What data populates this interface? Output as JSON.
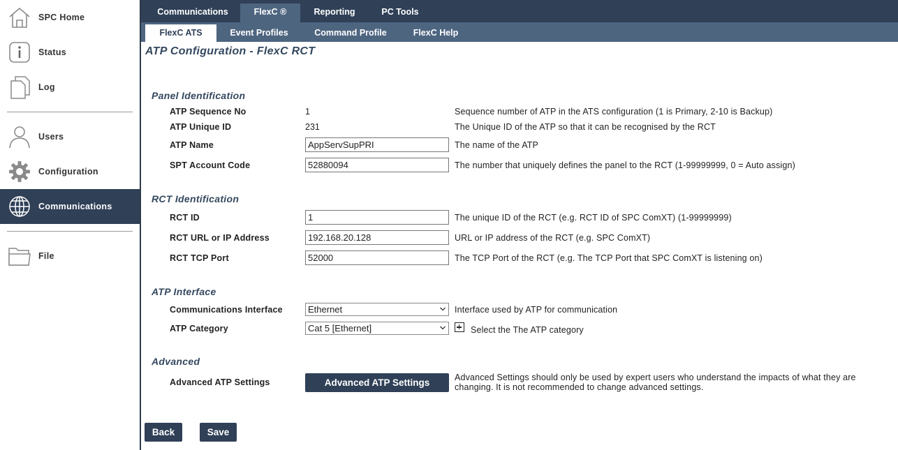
{
  "sidebar": {
    "items": [
      {
        "label": "SPC Home",
        "icon": "home-icon"
      },
      {
        "label": "Status",
        "icon": "info-icon"
      },
      {
        "label": "Log",
        "icon": "log-icon"
      },
      {
        "label": "Users",
        "icon": "user-icon"
      },
      {
        "label": "Configuration",
        "icon": "gear-icon"
      },
      {
        "label": "Communications",
        "icon": "globe-icon",
        "active": true
      },
      {
        "label": "File",
        "icon": "folder-icon"
      }
    ]
  },
  "topnav": {
    "tabs": [
      {
        "label": "Communications"
      },
      {
        "label": "FlexC ®",
        "active": true
      },
      {
        "label": "Reporting"
      },
      {
        "label": "PC Tools"
      }
    ]
  },
  "subnav": {
    "tabs": [
      {
        "label": "FlexC ATS",
        "active": true
      },
      {
        "label": "Event Profiles"
      },
      {
        "label": "Command Profile"
      },
      {
        "label": "FlexC Help"
      }
    ]
  },
  "page": {
    "title": "ATP Configuration - FlexC RCT"
  },
  "panel_identification": {
    "title": "Panel Identification",
    "sequence_no": {
      "label": "ATP Sequence No",
      "value": "1",
      "desc": "Sequence number of ATP in the ATS configuration (1 is Primary, 2-10 is Backup)"
    },
    "unique_id": {
      "label": "ATP Unique ID",
      "value": "231",
      "desc": "The Unique ID of the ATP so that it can be recognised by the RCT"
    },
    "atp_name": {
      "label": "ATP Name",
      "value": "AppServSupPRI",
      "desc": "The name of the ATP"
    },
    "spt_account": {
      "label": "SPT Account Code",
      "value": "52880094",
      "desc": "The number that uniquely defines the panel to the RCT (1-99999999, 0 = Auto assign)"
    }
  },
  "rct_identification": {
    "title": "RCT Identification",
    "rct_id": {
      "label": "RCT ID",
      "value": "1",
      "desc": "The unique ID of the RCT (e.g. RCT ID of SPC ComXT) (1-99999999)"
    },
    "rct_url": {
      "label": "RCT URL or IP Address",
      "value": "192.168.20.128",
      "desc": "URL or IP address of the RCT (e.g. SPC ComXT)"
    },
    "rct_port": {
      "label": "RCT TCP Port",
      "value": "52000",
      "desc": "The TCP Port of the RCT (e.g. The TCP Port that SPC ComXT is listening on)"
    }
  },
  "atp_interface": {
    "title": "ATP Interface",
    "comm_interface": {
      "label": "Communications Interface",
      "value": "Ethernet",
      "desc": "Interface used by ATP for communication"
    },
    "category": {
      "label": "ATP Category",
      "value": "Cat 5 [Ethernet]",
      "desc": "Select the The ATP category"
    }
  },
  "advanced": {
    "title": "Advanced",
    "label": "Advanced ATP Settings",
    "button": "Advanced ATP Settings",
    "desc_line1": "Advanced Settings should only be used by expert users who understand the impacts of what they are",
    "desc_line2": "changing. It is not recommended to change advanced settings."
  },
  "footer": {
    "back": "Back",
    "save": "Save"
  }
}
